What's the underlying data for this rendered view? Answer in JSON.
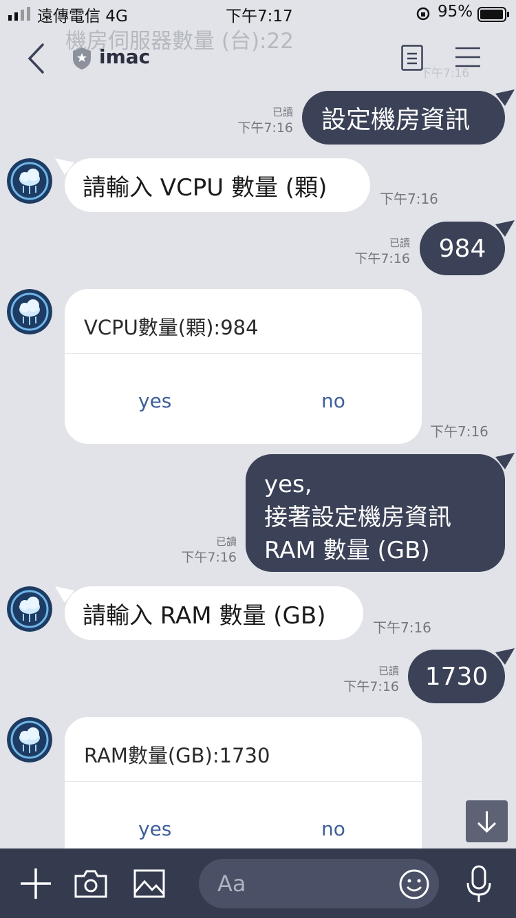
{
  "status_bar": {
    "carrier": "遠傳電信 4G",
    "time": "下午7:17",
    "battery": "95%"
  },
  "header": {
    "title": "imac",
    "ghost_title": "機房伺服器數量 (台):22",
    "ghost_time": "下午7:16"
  },
  "messages": [
    {
      "text": "設定機房資訊",
      "read": "已讀",
      "time": "下午7:16"
    },
    {
      "text": "請輸入 VCPU 數量 (顆)",
      "time": "下午7:16"
    },
    {
      "text": "984",
      "read": "已讀",
      "time": "下午7:16"
    },
    {
      "title": "VCPU數量(顆):984",
      "yes": "yes",
      "no": "no",
      "time": "下午7:16"
    },
    {
      "line1": "yes,",
      "line2": "接著設定機房資訊",
      "line3": "RAM 數量 (GB)",
      "read": "已讀",
      "time": "下午7:16"
    },
    {
      "text": "請輸入 RAM 數量 (GB)",
      "time": "下午7:16"
    },
    {
      "text": "1730",
      "read": "已讀",
      "time": "下午7:16"
    },
    {
      "title": "RAM數量(GB):1730",
      "yes": "yes",
      "no": "no"
    }
  ],
  "input": {
    "placeholder": "Aa"
  },
  "colors": {
    "background": "#e1e3e8",
    "outgoing": "#3b4156",
    "incoming": "#ffffff",
    "input_bar": "#353b4f",
    "option": "#3d5f9b"
  }
}
